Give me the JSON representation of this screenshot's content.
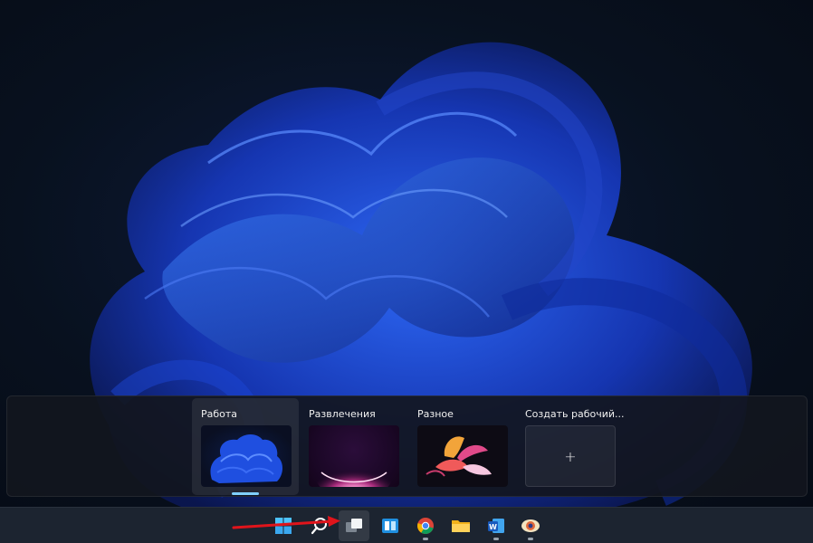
{
  "desktops": [
    {
      "label": "Работа",
      "active": true
    },
    {
      "label": "Развлечения",
      "active": false
    },
    {
      "label": "Разное",
      "active": false
    }
  ],
  "new_desktop": {
    "label": "Создать рабочий...",
    "plus": "+"
  },
  "taskbar": {
    "items": [
      {
        "name": "start-icon"
      },
      {
        "name": "search-icon"
      },
      {
        "name": "task-view-icon"
      },
      {
        "name": "widgets-icon"
      },
      {
        "name": "chrome-icon"
      },
      {
        "name": "file-explorer-icon"
      },
      {
        "name": "word-icon"
      },
      {
        "name": "eye-app-icon"
      }
    ]
  },
  "colors": {
    "accent_underline": "#7fd0ff",
    "arrow": "#e0141b",
    "taskbar": "#1c2430"
  }
}
